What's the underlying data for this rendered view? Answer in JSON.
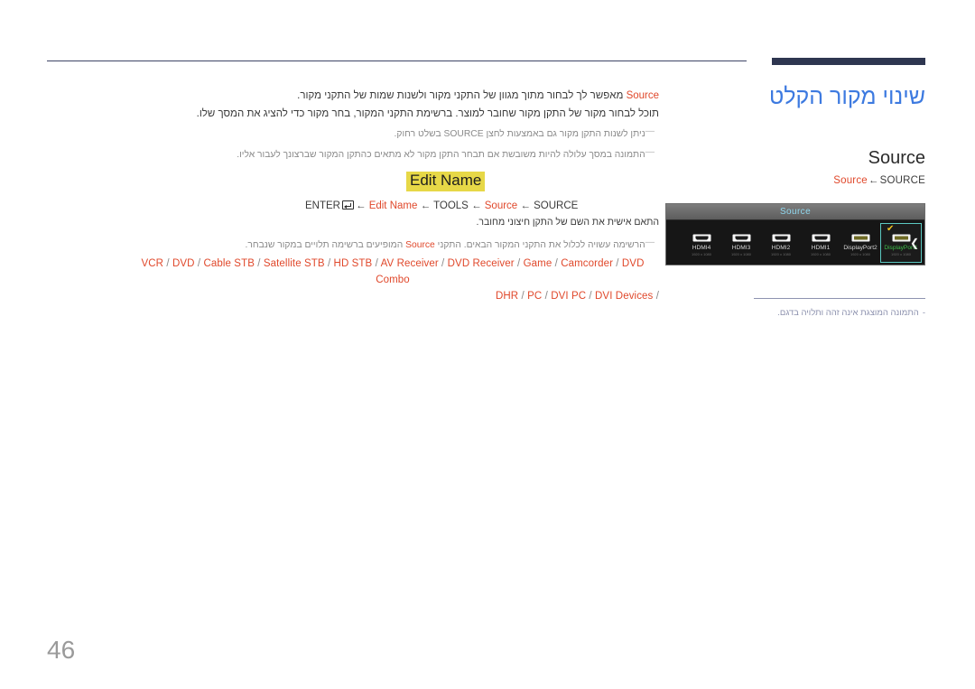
{
  "page": {
    "number": "46",
    "title": "שינוי מקור הקלט"
  },
  "menu": {
    "heading": "Source",
    "breadcrumb": {
      "root": "SOURCE",
      "arrow": "←",
      "leaf": "Source"
    }
  },
  "intro": {
    "line1_pre": "מאפשר לך לבחור מתוך מגוון של התקני מקור ולשנות שמות של התקני מקור.",
    "line1_keyword": "Source",
    "line2": "תוכל לבחור מקור של התקן מקור שחובר למוצר. ברשימת התקני המקור, בחר מקור כדי להציג את המסך שלו."
  },
  "notes": [
    {
      "dash": "—",
      "text_before": "ניתן לשנות התקן מקור גם באמצעות לחצן",
      "keyword": "SOURCE",
      "text_after": "בשלט רחוק."
    },
    {
      "dash": "—",
      "text": "התמונה במסך עלולה להיות משובשת אם תבחר התקן מקור לא מתאים כהתקן המקור שברצונך לעבור אליו."
    }
  ],
  "edit_name": {
    "title": "Edit Name",
    "breadcrumb": {
      "root": "SOURCE",
      "level2": "Source",
      "level3": "TOOLS",
      "level4": "Edit Name",
      "action": "ENTER",
      "arrow": "←",
      "key_icon": "enter-key-icon"
    },
    "description": "התאם אישית את השם של התקן חיצוני מחובר.",
    "list_note": {
      "dash": "—",
      "text_before": "הרשימה עשויה לכלול את התקני המקור הבאים. התקני",
      "keyword": "Source",
      "text_after": "המופיעים ברשימה תלויים במקור שנבחר."
    },
    "devices_row1": [
      "VCR",
      "DVD",
      "Cable STB",
      "Satellite STB",
      "HD STB",
      "AV Receiver",
      "DVD Receiver",
      "Game",
      "Camcorder",
      "DVD Combo"
    ],
    "devices_row2": [
      "DHR",
      "PC",
      "DVI PC",
      "DVI Devices"
    ],
    "separator": "/"
  },
  "tv_panel": {
    "title": "Source",
    "next_arrow_icon": "chevron-right-icon",
    "check_icon": "✔",
    "sources": [
      {
        "label": "DisplayPort1",
        "sub": "1920 x 1080",
        "icon": "displayport-icon",
        "selected": true
      },
      {
        "label": "DisplayPort2",
        "sub": "1920 x 1080",
        "icon": "displayport-icon",
        "selected": false
      },
      {
        "label": "HDMI1",
        "sub": "1920 x 1080",
        "icon": "hdmi-icon",
        "selected": false
      },
      {
        "label": "HDMI2",
        "sub": "1920 x 1080",
        "icon": "hdmi-icon",
        "selected": false
      },
      {
        "label": "HDMI3",
        "sub": "1920 x 1080",
        "icon": "hdmi-icon",
        "selected": false
      },
      {
        "label": "HDMI4",
        "sub": "1920 x 1080",
        "icon": "hdmi-icon",
        "selected": false
      }
    ]
  },
  "figure_note": {
    "dash": "-",
    "text": "התמונה המוצגת אינה זהה ותלויה בדגם."
  },
  "colors": {
    "title_blue": "#3d7ae0",
    "keyword_red": "#e0482b",
    "highlight_yellow": "#e7d847",
    "rule_dark": "#2e3650",
    "note_gray": "#8b90ad",
    "panel_bg": "#141414",
    "selected_green": "#3fbd4a",
    "selected_border": "#5bc8c0",
    "check_yellow": "#f0c420",
    "panel_title_blue": "#8fd8ef"
  }
}
